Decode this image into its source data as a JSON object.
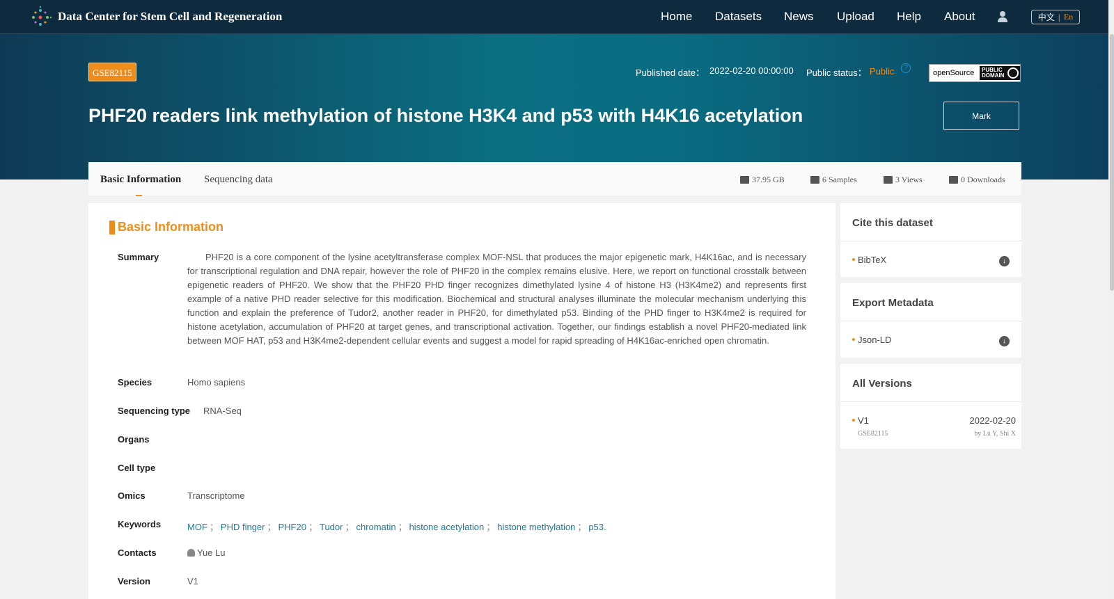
{
  "nav": {
    "brand": "Data Center for Stem Cell and Regeneration",
    "links": [
      "Home",
      "Datasets",
      "News",
      "Upload",
      "Help",
      "About"
    ],
    "lang_zh": "中文",
    "lang_sep": "|",
    "lang_en": "En"
  },
  "dataset": {
    "accession": "GSE82115",
    "published_label": "Published date：",
    "published_value": "2022-02-20 00:00:00",
    "status_label": "Public status：",
    "status_value": "Public",
    "help_symbol": "?",
    "license_label": "openSource",
    "license_badge_line1": "PUBLIC",
    "license_badge_line2": "DOMAIN",
    "title": "PHF20 readers link methylation of histone H3K4 and p53 with H4K16 acetylation",
    "mark_label": "Mark"
  },
  "tabs": {
    "basic": "Basic Information",
    "sequencing": "Sequencing data"
  },
  "stats": {
    "size": "37.95 GB",
    "samples": "6 Samples",
    "views": "3 Views",
    "downloads": "0 Downloads"
  },
  "basic_info": {
    "section_title": "Basic Information",
    "summary_label": "Summary",
    "summary": "PHF20 is a core component of the lysine acetyltransferase complex MOF-NSL that produces the major epigenetic mark, H4K16ac, and is necessary for transcriptional regulation and DNA repair, however the role of PHF20 in the complex remains elusive. Here, we report on functional crosstalk between epigenetic readers of PHF20. We show that the PHF20 PHD finger recognizes dimethylated lysine 4 of histone H3 (H3K4me2) and represents first example of a native PHD reader selective for this modification. Biochemical and structural analyses illuminate the molecular mechanism underlying this function and explain the preference of Tudor2, another reader in PHF20, for dimethylated p53. Binding of the PHD finger to H3K4me2 is required for histone acetylation, accumulation of PHF20 at target genes, and transcriptional activation. Together, our findings establish a novel PHF20-mediated link between MOF HAT, p53 and H3K4me2-dependent cellular events and suggest a model for rapid spreading of H4K16ac-enriched open chromatin.",
    "species_label": "Species",
    "species": "Homo sapiens",
    "seqtype_label": "Sequencing type",
    "seqtype": "RNA-Seq",
    "organs_label": "Organs",
    "organs": "",
    "celltype_label": "Cell type",
    "celltype": "",
    "omics_label": "Omics",
    "omics": "Transcriptome",
    "keywords_label": "Keywords",
    "keywords": [
      "MOF",
      "PHD finger",
      "PHF20",
      "Tudor",
      "chromatin",
      "histone acetylation",
      "histone methylation",
      "p53."
    ],
    "keyword_sep": "；",
    "contacts_label": "Contacts",
    "contact": "Yue Lu",
    "version_label": "Version",
    "version": "V1"
  },
  "sidebar": {
    "cite_title": "Cite this dataset",
    "cite_item": "BibTeX",
    "export_title": "Export Metadata",
    "export_item": "Json-LD",
    "versions_title": "All Versions",
    "version_name": "V1",
    "version_date": "2022-02-20",
    "version_accession": "GSE82115",
    "version_authors": "by Lu Y, Shi X"
  },
  "colors": {
    "accent": "#f08c1a",
    "nav_bg": "#0e2a3e",
    "banner_teal": "#0b6f82",
    "link": "#1a7a9a"
  },
  "icons": [
    "logo-icon",
    "user-icon",
    "help-icon",
    "storage-icon",
    "samples-icon",
    "views-icon",
    "downloads-icon",
    "person-icon",
    "download-circle-icon"
  ]
}
